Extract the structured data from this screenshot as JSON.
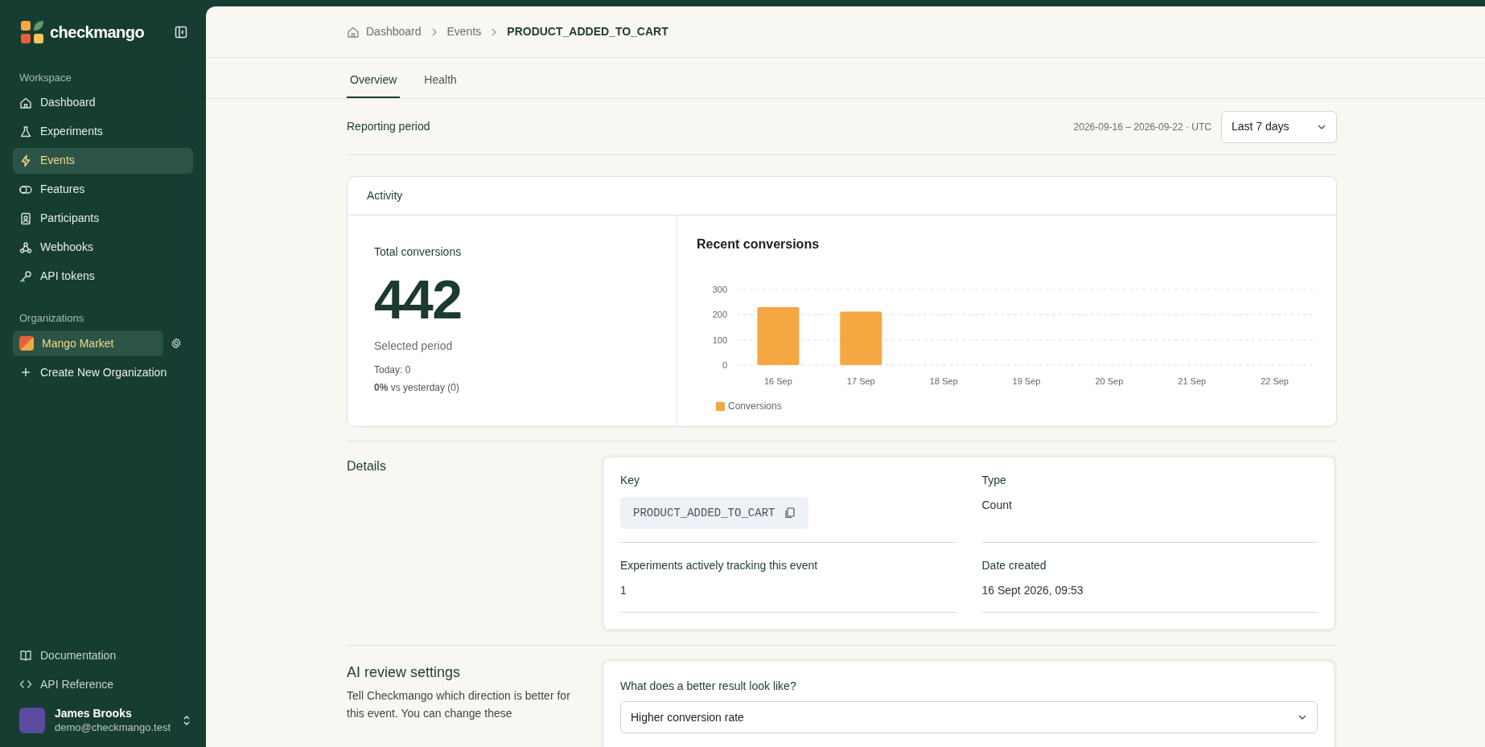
{
  "sidebar": {
    "brand": "checkmango",
    "workspace_label": "Workspace",
    "items": [
      {
        "label": "Dashboard",
        "kind": "home",
        "selected": false
      },
      {
        "label": "Experiments",
        "kind": "flask",
        "selected": false
      },
      {
        "label": "Events",
        "kind": "bolt",
        "selected": true
      },
      {
        "label": "Features",
        "kind": "toggle",
        "selected": false
      },
      {
        "label": "Participants",
        "kind": "badge",
        "selected": false
      },
      {
        "label": "Webhooks",
        "kind": "webhook",
        "selected": false
      },
      {
        "label": "API tokens",
        "kind": "key",
        "selected": false
      }
    ],
    "organizations_label": "Organizations",
    "organizations": [
      {
        "label": "Mango Market",
        "selected": true
      }
    ],
    "create_org": "Create New Organization",
    "footer_links": [
      {
        "label": "Documentation",
        "kind": "book"
      },
      {
        "label": "API Reference",
        "kind": "code"
      }
    ],
    "user": {
      "name": "James Brooks",
      "email": "demo@checkmango.test"
    }
  },
  "breadcrumb": [
    "Dashboard",
    "Events",
    "PRODUCT_ADDED_TO_CART"
  ],
  "tabs": [
    {
      "label": "Overview",
      "selected": true
    },
    {
      "label": "Health",
      "selected": false
    }
  ],
  "reporting": {
    "label": "Reporting period",
    "range": "2026-09-16 – 2026-09-22 · UTC",
    "period": "Last 7 days"
  },
  "activity": {
    "title": "Activity",
    "total_label": "Total conversions",
    "total": "442",
    "period_label": "Selected period",
    "today": "Today: 0",
    "comparison": "**0%** vs yesterday (0)",
    "chart_title": "Recent conversions",
    "chart_data": {
      "type": "bar",
      "categories": [
        "16 Sep",
        "17 Sep",
        "18 Sep",
        "19 Sep",
        "20 Sep",
        "21 Sep",
        "22 Sep"
      ],
      "series": [
        {
          "name": "Conversions",
          "color": "#f5a742",
          "values": [
            230,
            212,
            0,
            0,
            0,
            0,
            0
          ]
        }
      ],
      "ylim": [
        0,
        300
      ],
      "yticks": [
        0,
        100,
        200,
        300
      ]
    }
  },
  "details": {
    "title": "Details",
    "fields": [
      {
        "label": "Key",
        "value": "PRODUCT_ADDED_TO_CART",
        "kind": "code"
      },
      {
        "label": "Type",
        "value": "Count",
        "kind": "text"
      },
      {
        "label": "Experiments actively tracking this event",
        "value": "1",
        "kind": "text"
      },
      {
        "label": "Date created",
        "value": "16 Sept 2026, 09:53",
        "kind": "text"
      }
    ]
  },
  "ai_review": {
    "title": "AI review settings",
    "description": "Tell Checkmango which direction is better for this event. You can change these",
    "question": "What does a better result look like?",
    "answer": "Higher conversion rate"
  }
}
